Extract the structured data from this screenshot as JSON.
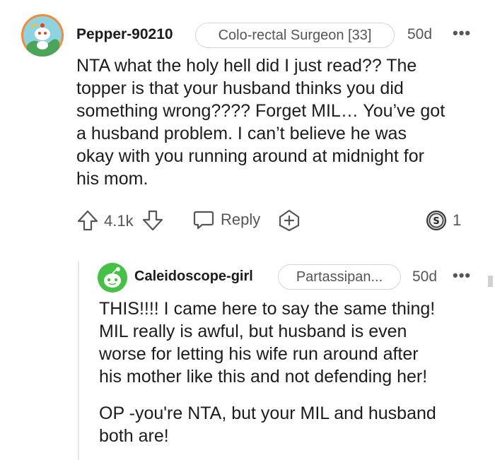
{
  "comment": {
    "username": "Pepper-90210",
    "flair": "Colo-rectal Surgeon [33]",
    "age": "50d",
    "more": "•••",
    "body_lines": [
      "NTA what the holy hell did I just read?? The",
      "topper is that your husband thinks you did",
      "something wrong???? Forget MIL… You’ve got",
      "a husband problem. I can’t believe he was",
      "okay with you running around at midnight for",
      "his mom."
    ],
    "votes": "4.1k",
    "reply_label": "Reply",
    "award_count": "1"
  },
  "reply": {
    "username": "Caleidoscope-girl",
    "flair": "Partassipan...",
    "age": "50d",
    "more": "•••",
    "para1_lines": [
      "THIS!!!! I came here to say the same thing!",
      "MIL really is awful, but husband is even",
      "worse for letting his wife run around after",
      "his mother like this and not defending her!"
    ],
    "para2_lines": [
      "OP -you're NTA, but your MIL and husband",
      "both are!"
    ]
  },
  "icons": {
    "upvote": "arrow-up-icon",
    "downvote": "arrow-down-icon",
    "reply": "speech-bubble-icon",
    "award": "plus-award-icon",
    "silver": "silver-award-icon"
  }
}
